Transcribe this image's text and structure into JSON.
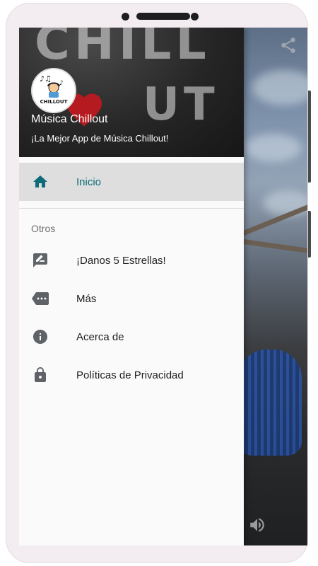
{
  "app": {
    "title": "Música Chillout",
    "subtitle": "¡La Mejor App de Música Chillout!",
    "logo_text": "CHILLOUT",
    "header_chalk_line1": "CHILL",
    "header_chalk_line2": "UT"
  },
  "menu": {
    "home": {
      "label": "Inicio",
      "icon": "home-icon",
      "active": true
    },
    "section_label": "Otros",
    "items": [
      {
        "label": "¡Danos 5 Estrellas!",
        "icon": "rate-edit-icon"
      },
      {
        "label": "Más",
        "icon": "more-tag-icon"
      },
      {
        "label": "Acerca de",
        "icon": "info-icon"
      },
      {
        "label": "Políticas de Privacidad",
        "icon": "lock-icon"
      }
    ]
  },
  "background_controls": {
    "share": "share-icon",
    "volume": "volume-icon"
  },
  "colors": {
    "accent": "#0e6c79",
    "icon": "#5f6368",
    "drawer_bg": "#fafafa",
    "active_item_bg": "#dedede"
  }
}
